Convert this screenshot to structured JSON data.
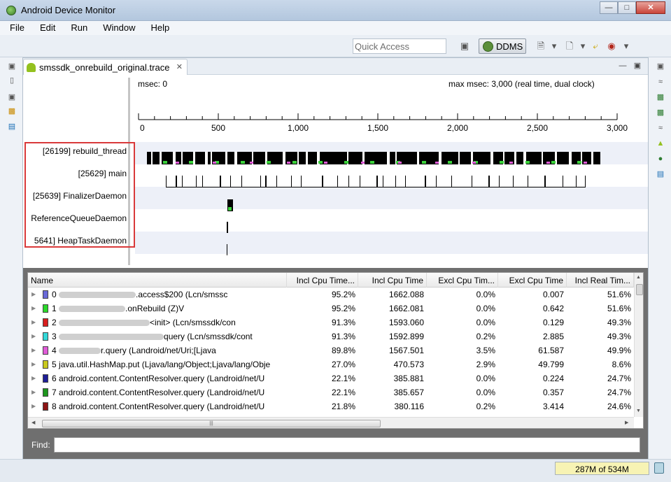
{
  "window": {
    "title": "Android Device Monitor"
  },
  "menu": [
    "File",
    "Edit",
    "Run",
    "Window",
    "Help"
  ],
  "toolbar": {
    "quick_access_placeholder": "Quick Access",
    "ddms_label": "DDMS"
  },
  "editor_tab": {
    "title": "smssdk_onrebuild_original.trace"
  },
  "timeline": {
    "msec_min": "msec: 0",
    "msec_max": "max msec: 3,000 (real time, dual clock)",
    "ticks": [
      "0",
      "500",
      "1,000",
      "1,500",
      "2,000",
      "2,500",
      "3,000"
    ],
    "threads": [
      {
        "label": "[26199] rebuild_thread"
      },
      {
        "label": "[25629] main"
      },
      {
        "label": "[25639] FinalizerDaemon"
      },
      {
        "label": "ReferenceQueueDaemon"
      },
      {
        "label": "5641] HeapTaskDaemon"
      }
    ]
  },
  "profile": {
    "columns": [
      "Name",
      "Incl Cpu Time...",
      "Incl Cpu Time",
      "Excl Cpu Tim...",
      "Excl Cpu Time",
      "Incl Real Tim..."
    ],
    "rows": [
      {
        "color": "#6a6ad8",
        "prefix": "0",
        "name": ".access$200 (Lcn/smssc",
        "incl_pct": "95.2%",
        "incl": "1662.088",
        "excl_pct": "0.0%",
        "excl": "0.007",
        "real_pct": "51.6%"
      },
      {
        "color": "#2ad82a",
        "prefix": "1",
        "name": ".onRebuild (Z)V",
        "incl_pct": "95.2%",
        "incl": "1662.081",
        "excl_pct": "0.0%",
        "excl": "0.642",
        "real_pct": "51.6%"
      },
      {
        "color": "#d81e1e",
        "prefix": "2",
        "name": "<init> (Lcn/smssdk/con",
        "incl_pct": "91.3%",
        "incl": "1593.060",
        "excl_pct": "0.0%",
        "excl": "0.129",
        "real_pct": "49.3%"
      },
      {
        "color": "#33d8d8",
        "prefix": "3",
        "name": "query (Lcn/smssdk/cont",
        "incl_pct": "91.3%",
        "incl": "1592.899",
        "excl_pct": "0.2%",
        "excl": "2.885",
        "real_pct": "49.3%"
      },
      {
        "color": "#e05bd8",
        "prefix": "4",
        "name": "r.query (Landroid/net/Uri;[Ljava",
        "incl_pct": "89.8%",
        "incl": "1567.501",
        "excl_pct": "3.5%",
        "excl": "61.587",
        "real_pct": "49.9%"
      },
      {
        "color": "#c8c81e",
        "prefix": "5",
        "name": "java.util.HashMap.put (Ljava/lang/Object;Ljava/lang/Obje",
        "incl_pct": "27.0%",
        "incl": "470.573",
        "excl_pct": "2.9%",
        "excl": "49.799",
        "real_pct": "8.6%"
      },
      {
        "color": "#1e1e96",
        "prefix": "6",
        "name": "android.content.ContentResolver.query (Landroid/net/U",
        "incl_pct": "22.1%",
        "incl": "385.881",
        "excl_pct": "0.0%",
        "excl": "0.224",
        "real_pct": "24.7%"
      },
      {
        "color": "#1e961e",
        "prefix": "7",
        "name": "android.content.ContentResolver.query (Landroid/net/U",
        "incl_pct": "22.1%",
        "incl": "385.657",
        "excl_pct": "0.0%",
        "excl": "0.357",
        "real_pct": "24.7%"
      },
      {
        "color": "#8c1414",
        "prefix": "8",
        "name": "android.content.ContentResolver.query (Landroid/net/U",
        "incl_pct": "21.8%",
        "incl": "380.116",
        "excl_pct": "0.2%",
        "excl": "3.414",
        "real_pct": "24.6%"
      }
    ],
    "find_label": "Find:",
    "find_value": ""
  },
  "status": {
    "heap": "287M of 534M"
  }
}
